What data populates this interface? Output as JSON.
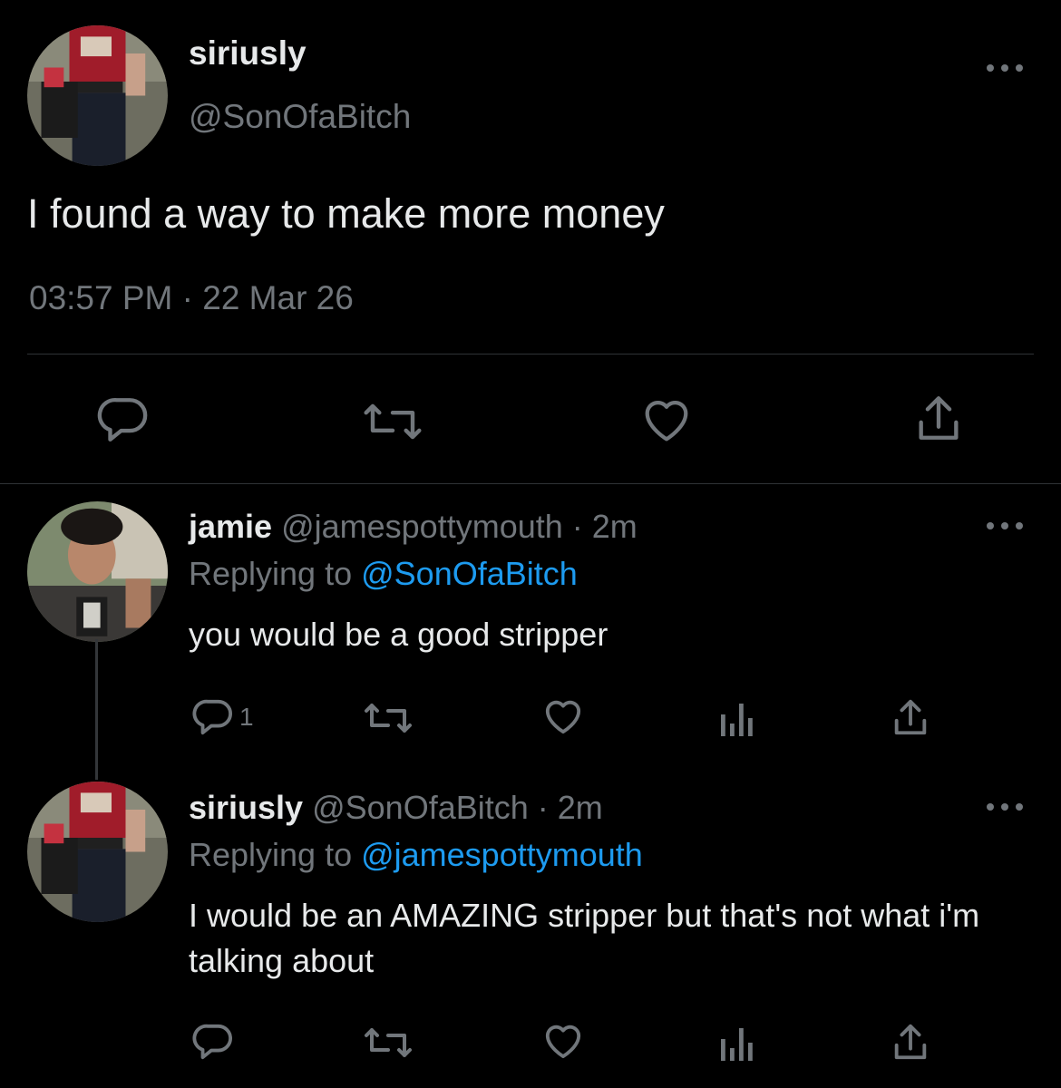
{
  "main_tweet": {
    "name": "siriusly",
    "handle": "@SonOfaBitch",
    "text": "I found a way to make more money",
    "timestamp": "03:57 PM · 22 Mar 26",
    "avatar_icon": "avatar-photo",
    "actions": [
      {
        "icon": "reply-icon"
      },
      {
        "icon": "retweet-icon"
      },
      {
        "icon": "like-icon"
      },
      {
        "icon": "share-icon"
      }
    ]
  },
  "replies": [
    {
      "name": "jamie",
      "handle_time": "@jamespottymouth · 2m",
      "replying_prefix": "Replying to ",
      "replying_to": "@SonOfaBitch",
      "text": "you would be a good stripper",
      "reply_count": "1",
      "avatar_icon": "avatar-photo"
    },
    {
      "name": "siriusly",
      "handle_time": "@SonOfaBitch · 2m",
      "replying_prefix": "Replying to ",
      "replying_to": "@jamespottymouth",
      "text": "I would be an AMAZING stripper but that's not what i'm talking about",
      "reply_count": "",
      "avatar_icon": "avatar-photo"
    }
  ],
  "colors": {
    "background": "#000000",
    "primary_text": "#e7e9ea",
    "secondary_text": "#71767b",
    "link": "#1d9bf0",
    "divider": "#2f3336"
  }
}
